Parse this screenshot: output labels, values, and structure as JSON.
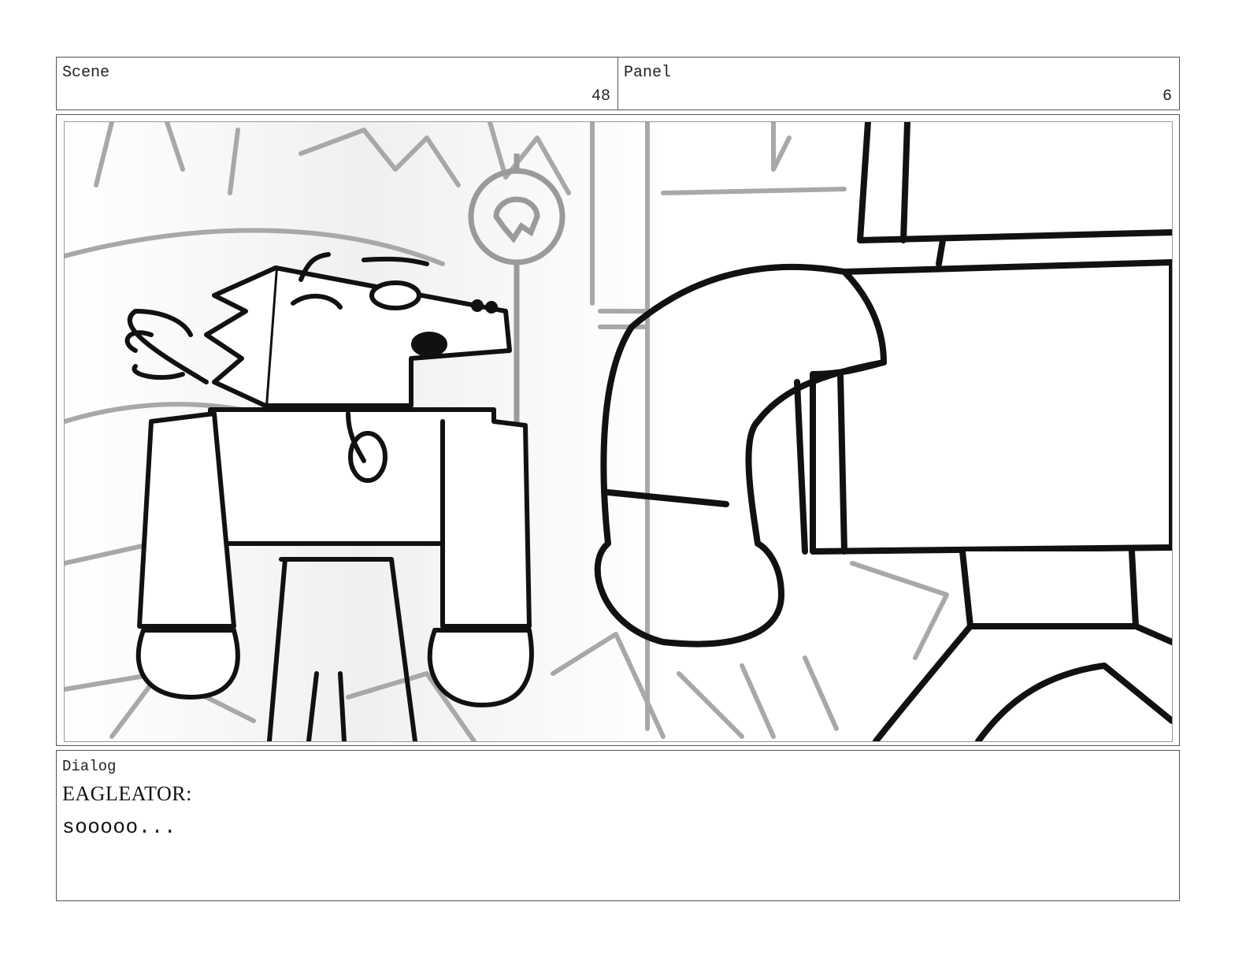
{
  "scene": {
    "label": "Scene",
    "number": "48"
  },
  "panel": {
    "label": "Panel",
    "number": "6"
  },
  "dialog": {
    "label": "Dialog",
    "speaker": "EAGLEATOR:",
    "line": "sooooo..."
  },
  "colors": {
    "border": "#555555",
    "ink": "#111111",
    "sketch_gray": "#9a9a9a"
  }
}
